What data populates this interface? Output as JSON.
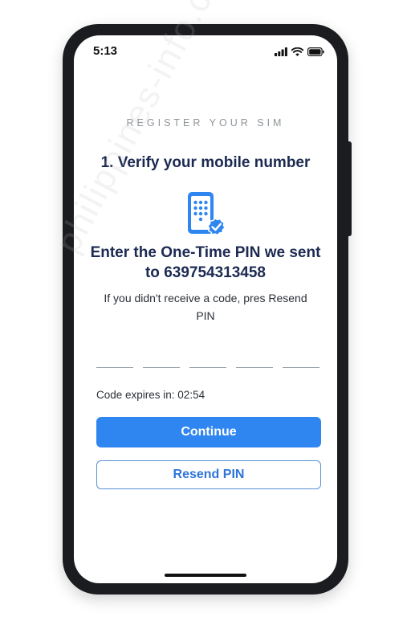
{
  "status_bar": {
    "time": "5:13",
    "icons": [
      "signal-icon",
      "wifi-icon",
      "battery-icon"
    ]
  },
  "screen": {
    "eyebrow": "REGISTER YOUR SIM",
    "step_title": "1. Verify your mobile number",
    "illustration_icon": "phone-check-icon",
    "headline_line1": "Enter the One-Time PIN we sent",
    "headline_line2": "to 639754313458",
    "hint": "If you didn't receive a code, pres Resend PIN",
    "pin_length": 5,
    "expires_label": "Code expires in: 02:54",
    "continue_label": "Continue",
    "resend_label": "Resend PIN"
  },
  "watermark": "philippines-info.com",
  "colors": {
    "primary": "#2f86f0",
    "heading": "#1c2a52",
    "secondary_text": "#2f74d8"
  }
}
